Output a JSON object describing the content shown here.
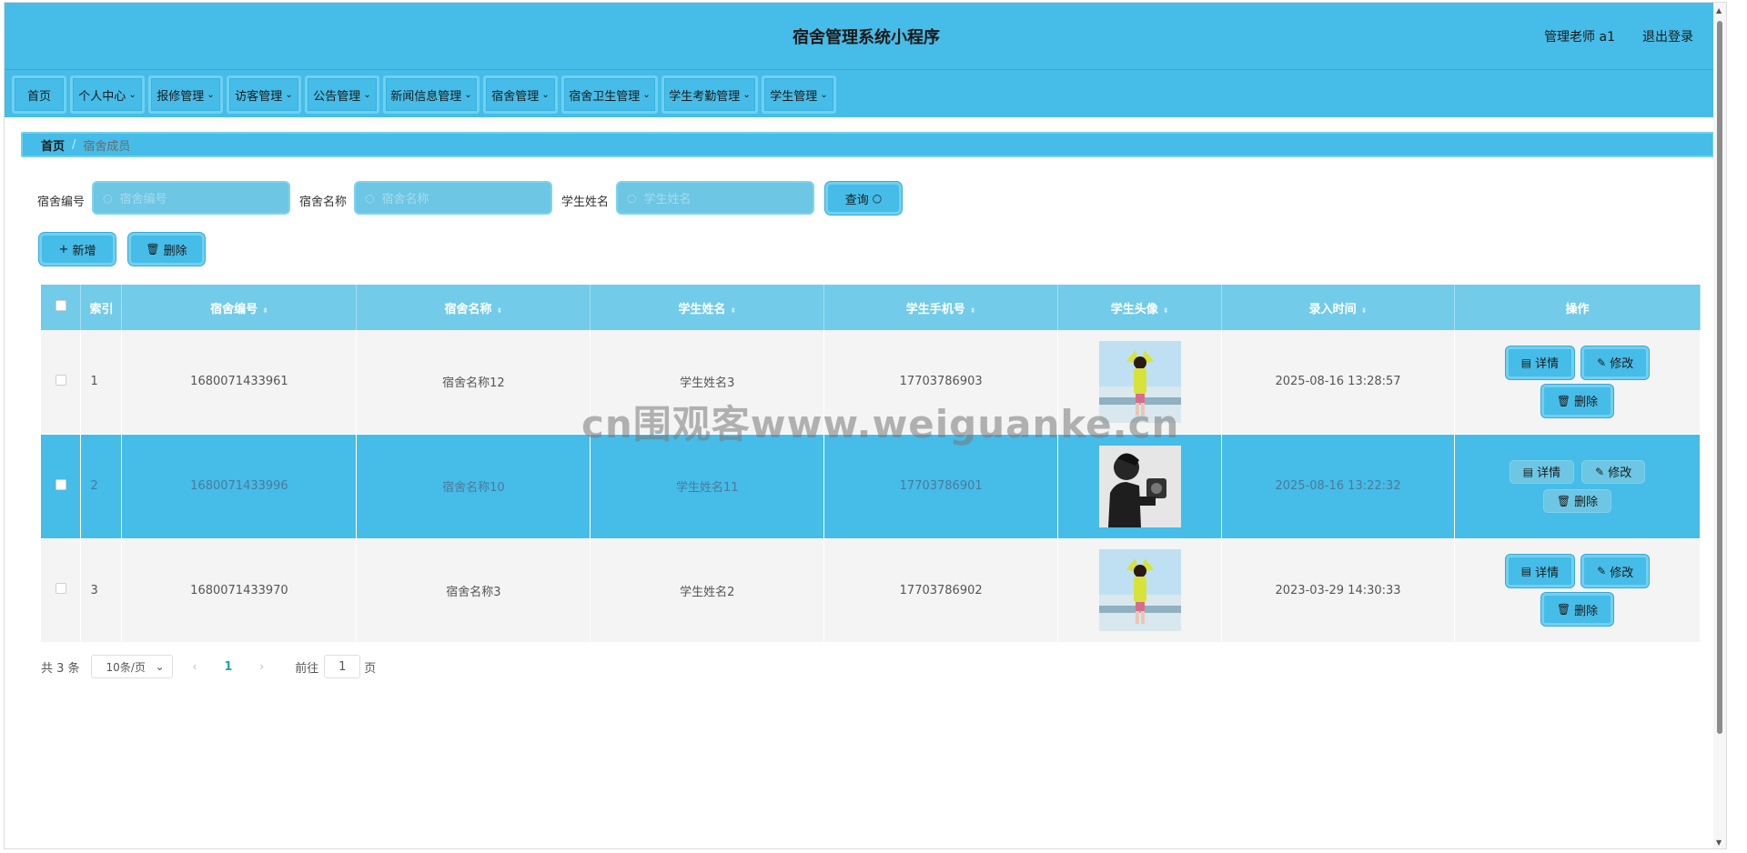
{
  "header": {
    "title": "宿舍管理系统小程序",
    "user": "管理老师 a1",
    "logout": "退出登录"
  },
  "nav": [
    {
      "label": "首页",
      "dropdown": false
    },
    {
      "label": "个人中心",
      "dropdown": true
    },
    {
      "label": "报修管理",
      "dropdown": true
    },
    {
      "label": "访客管理",
      "dropdown": true
    },
    {
      "label": "公告管理",
      "dropdown": true
    },
    {
      "label": "新闻信息管理",
      "dropdown": true
    },
    {
      "label": "宿舍管理",
      "dropdown": true
    },
    {
      "label": "宿舍卫生管理",
      "dropdown": true
    },
    {
      "label": "学生考勤管理",
      "dropdown": true
    },
    {
      "label": "学生管理",
      "dropdown": true
    }
  ],
  "breadcrumb": {
    "home": "首页",
    "sep": "/",
    "current": "宿舍成员"
  },
  "search": {
    "dorm_no_label": "宿舍编号",
    "dorm_no_placeholder": "宿舍编号",
    "dorm_name_label": "宿舍名称",
    "dorm_name_placeholder": "宿舍名称",
    "student_label": "学生姓名",
    "student_placeholder": "学生姓名",
    "query_button": "查询"
  },
  "actions": {
    "add": "新增",
    "delete": "删除"
  },
  "table": {
    "headers": [
      "索引",
      "宿舍编号",
      "宿舍名称",
      "学生姓名",
      "学生手机号",
      "学生头像",
      "录入时间",
      "操作"
    ],
    "rows": [
      {
        "index": "1",
        "dorm_no": "1680071433961",
        "dorm_name": "宿舍名称12",
        "student": "学生姓名3",
        "phone": "17703786903",
        "avatar": "girl-photo",
        "time": "2025-08-16 13:28:57",
        "highlighted": false
      },
      {
        "index": "2",
        "dorm_no": "1680071433996",
        "dorm_name": "宿舍名称10",
        "student": "学生姓名11",
        "phone": "17703786901",
        "avatar": "man-bw-photo",
        "time": "2025-08-16 13:22:32",
        "highlighted": true
      },
      {
        "index": "3",
        "dorm_no": "1680071433970",
        "dorm_name": "宿舍名称3",
        "student": "学生姓名2",
        "phone": "17703786902",
        "avatar": "girl-photo",
        "time": "2023-03-29 14:30:33",
        "highlighted": false
      }
    ],
    "ops": {
      "detail": "详情",
      "edit": "修改",
      "delete": "删除"
    }
  },
  "pager": {
    "total": "共 3 条",
    "page_size": "10条/页",
    "current_page": "1",
    "goto_prefix": "前往",
    "goto_value": "1",
    "goto_suffix": "页"
  },
  "watermark": "cn围观客www.weiguanke.cn",
  "colors": {
    "primary": "#46bce8",
    "border_light": "#6fd0f2",
    "header_cell": "#72cbe8"
  }
}
